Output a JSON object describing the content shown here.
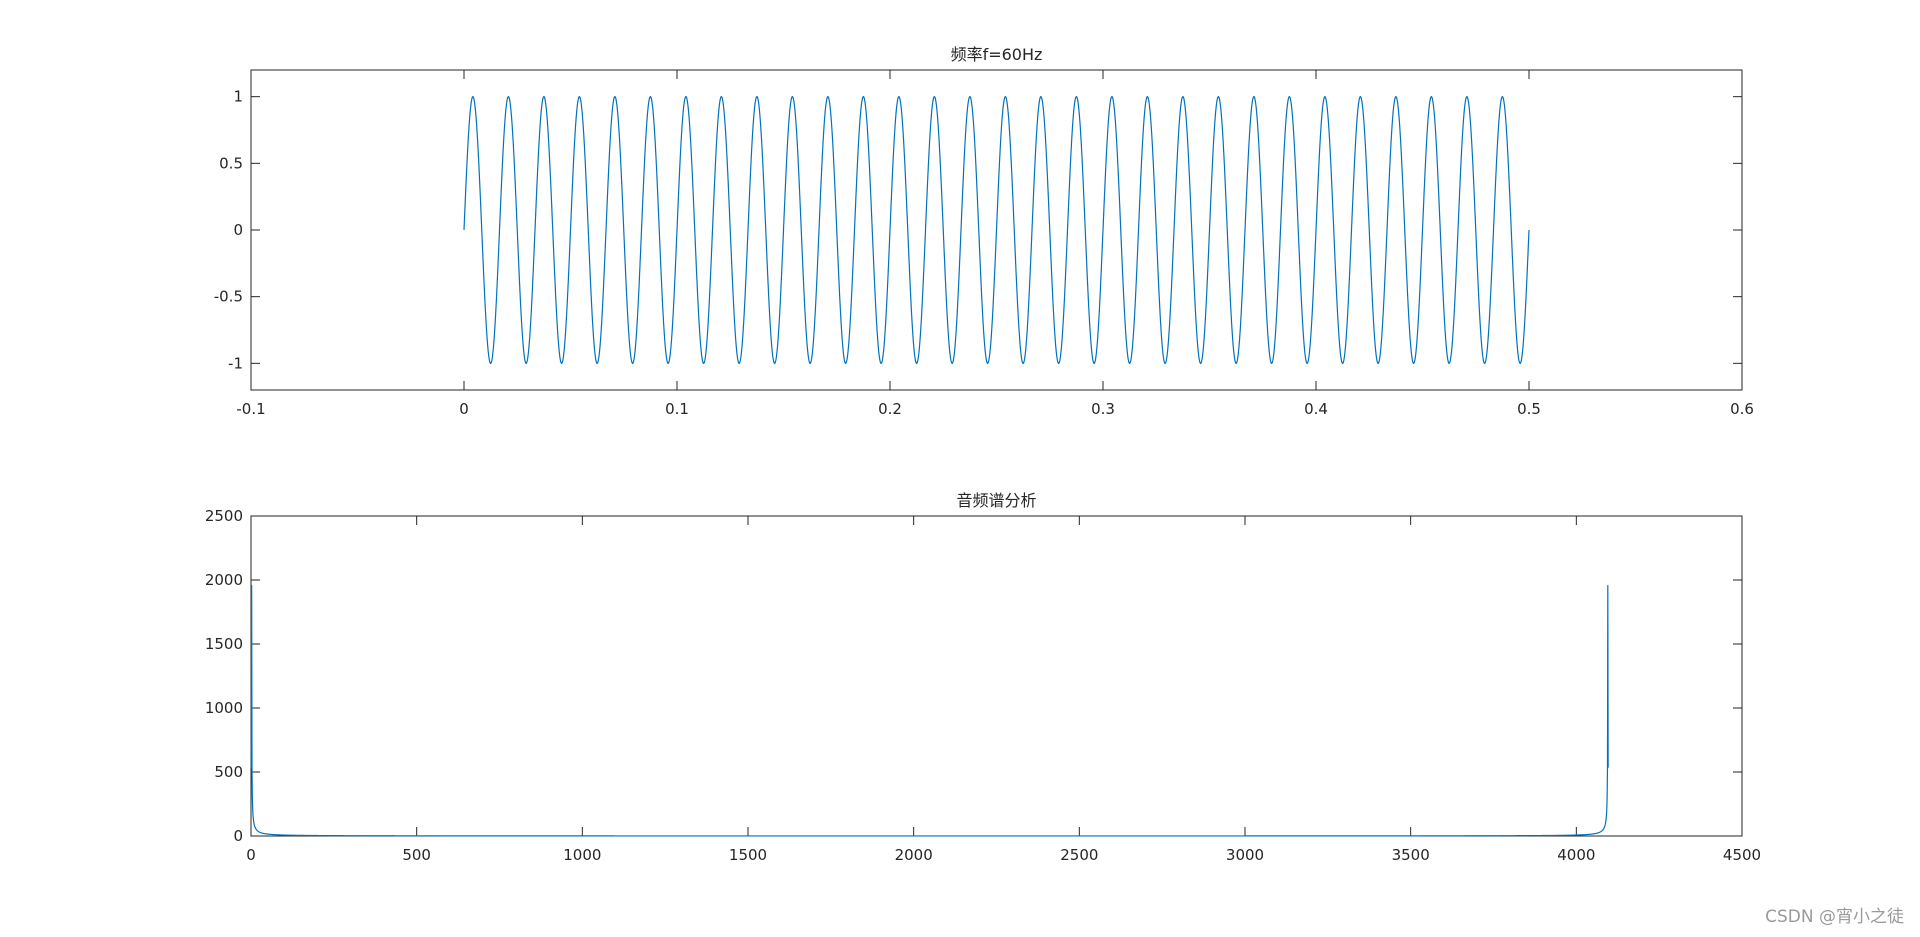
{
  "watermark": "CSDN @宵小之徒",
  "colors": {
    "series": "#0072BD",
    "axis": "#262626",
    "background": "#ffffff"
  },
  "chart_data": [
    {
      "type": "line",
      "title": "频率f=60Hz",
      "xlabel": "",
      "ylabel": "",
      "xlim": [
        -0.1,
        0.6
      ],
      "ylim": [
        -1.2,
        1.2
      ],
      "xticks": [
        -0.1,
        0,
        0.1,
        0.2,
        0.3,
        0.4,
        0.5,
        0.6
      ],
      "xtick_labels": [
        "-0.1",
        "0",
        "0.1",
        "0.2",
        "0.3",
        "0.4",
        "0.5",
        "0.6"
      ],
      "yticks": [
        -1,
        -0.5,
        0,
        0.5,
        1
      ],
      "ytick_labels": [
        "-1",
        "-0.5",
        "0",
        "0.5",
        "1"
      ],
      "grid": false,
      "series": [
        {
          "function": "sin(2*pi*f*t)",
          "frequency_hz": 60,
          "amplitude": 1,
          "t_start": 0,
          "t_end": 0.5
        }
      ]
    },
    {
      "type": "line",
      "title": "音频谱分析",
      "xlabel": "",
      "ylabel": "",
      "xlim": [
        0,
        4500
      ],
      "ylim": [
        0,
        2500
      ],
      "xticks": [
        0,
        500,
        1000,
        1500,
        2000,
        2500,
        3000,
        3500,
        4000,
        4500
      ],
      "xtick_labels": [
        "0",
        "500",
        "1000",
        "1500",
        "2000",
        "2500",
        "3000",
        "3500",
        "4000",
        "4500"
      ],
      "yticks": [
        0,
        500,
        1000,
        1500,
        2000,
        2500
      ],
      "ytick_labels": [
        "0",
        "500",
        "1000",
        "1500",
        "2000",
        "2500"
      ],
      "grid": false,
      "series": [
        {
          "kind": "magnitude-spectrum",
          "n_points": 4096,
          "peaks": [
            {
              "x": 2,
              "y": 1960
            },
            {
              "x": 4095,
              "y": 1960
            }
          ]
        }
      ]
    }
  ]
}
